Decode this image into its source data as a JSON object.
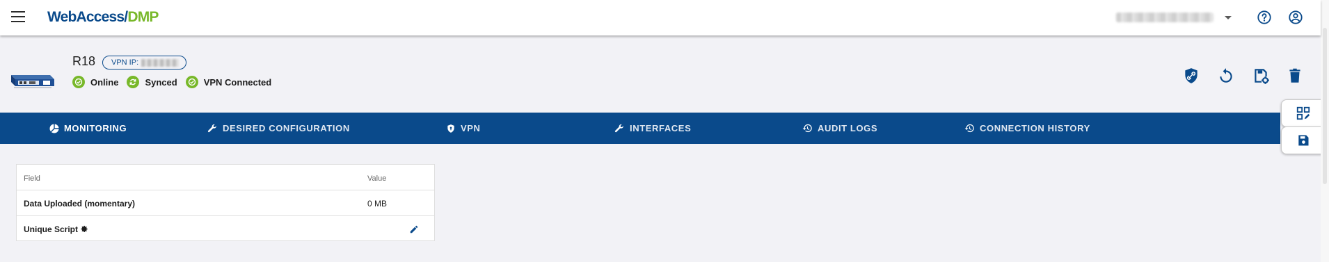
{
  "app": {
    "logo_primary": "WebAccess/",
    "logo_secondary": "DMP",
    "colors": {
      "primary": "#0a4a8b",
      "accent": "#78b82a",
      "background": "#f2f2f6"
    }
  },
  "topbar": {
    "menu_icon": "hamburger-menu-icon",
    "account_selector_icon": "chevron-down-icon",
    "help_icon": "help-circle-icon",
    "user_icon": "account-circle-icon"
  },
  "device": {
    "name": "R18",
    "vpn_ip_label": "VPN IP:",
    "statuses": [
      {
        "label": "Online",
        "icon": "check-circle-icon"
      },
      {
        "label": "Synced",
        "icon": "sync-icon"
      },
      {
        "label": "VPN Connected",
        "icon": "check-circle-icon"
      }
    ],
    "actions": [
      {
        "name": "vpn-shield-icon"
      },
      {
        "name": "restart-icon"
      },
      {
        "name": "save-settings-icon"
      },
      {
        "name": "delete-icon"
      }
    ]
  },
  "tabs": [
    {
      "label": "MONITORING",
      "icon": "monitoring-pie-icon",
      "active": true
    },
    {
      "label": "DESIRED CONFIGURATION",
      "icon": "wrench-icon"
    },
    {
      "label": "VPN",
      "icon": "shield-icon"
    },
    {
      "label": "INTERFACES",
      "icon": "wrench-icon"
    },
    {
      "label": "AUDIT LOGS",
      "icon": "history-icon"
    },
    {
      "label": "CONNECTION HISTORY",
      "icon": "history-icon"
    }
  ],
  "side_buttons": [
    {
      "icon": "qr-edit-icon"
    },
    {
      "icon": "save-icon"
    }
  ],
  "table": {
    "headers": {
      "field": "Field",
      "value": "Value"
    },
    "rows": [
      {
        "field": "Data Uploaded (momentary)",
        "value": "0 MB"
      },
      {
        "field": "Unique Script",
        "value": ""
      }
    ]
  }
}
